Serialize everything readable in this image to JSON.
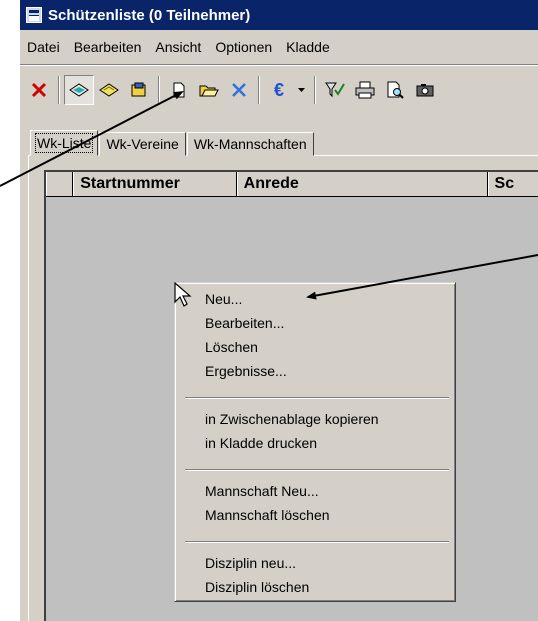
{
  "window": {
    "title": "Schützenliste (0 Teilnehmer)"
  },
  "menu": [
    "Datei",
    "Bearbeiten",
    "Ansicht",
    "Optionen",
    "Kladde"
  ],
  "toolbar": {
    "icons": [
      "close-icon",
      "view-icon",
      "open-book-icon",
      "book-icon",
      "new-document-icon",
      "open-folder-icon",
      "delete-icon",
      "euro-icon",
      "dropdown-arrow-icon",
      "filter-icon",
      "print-icon",
      "print-preview-icon",
      "camera-icon"
    ],
    "euro_label": "€"
  },
  "tabs": [
    {
      "label": "Wk-Liste",
      "active": true
    },
    {
      "label": "Wk-Vereine",
      "active": false
    },
    {
      "label": "Wk-Mannschaften",
      "active": false
    }
  ],
  "grid": {
    "columns": [
      "Startnummer",
      "Anrede",
      "Sc"
    ]
  },
  "context_menu": {
    "groups": [
      [
        "Neu...",
        "Bearbeiten...",
        "Löschen",
        "Ergebnisse..."
      ],
      [
        "in Zwischenablage kopieren",
        "in Kladde drucken"
      ],
      [
        "Mannschaft Neu...",
        "Mannschaft löschen"
      ],
      [
        "Disziplin neu...",
        "Disziplin löschen"
      ]
    ]
  }
}
